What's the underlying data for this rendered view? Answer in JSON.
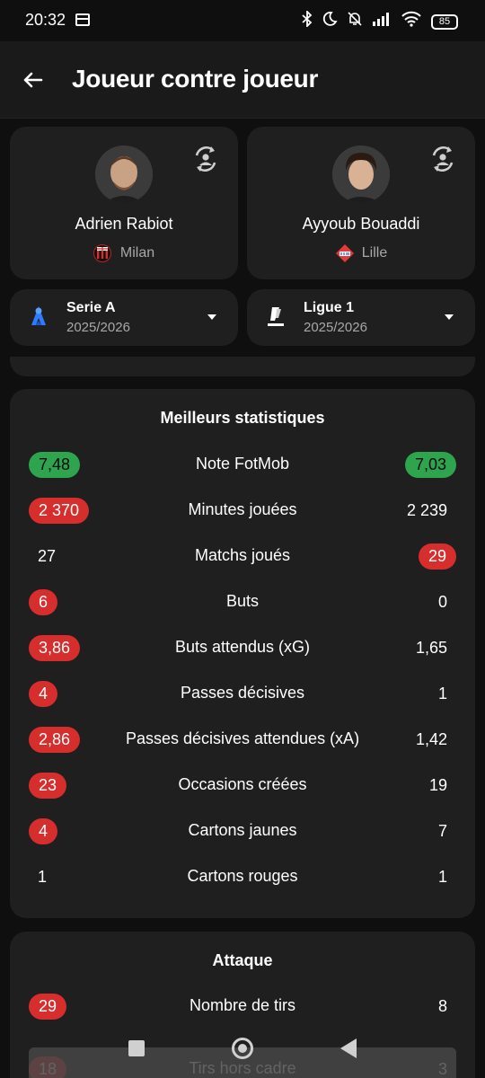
{
  "status_bar": {
    "time": "20:32",
    "battery": "85",
    "icons": [
      "bluetooth-icon",
      "moon-icon",
      "bell-off-icon",
      "signal-icon",
      "wifi-icon",
      "battery-icon"
    ]
  },
  "header": {
    "title": "Joueur contre joueur"
  },
  "players": [
    {
      "name": "Adrien Rabiot",
      "club": "Milan",
      "club_logo": "milan-crest-icon"
    },
    {
      "name": "Ayyoub Bouaddi",
      "club": "Lille",
      "club_logo": "lille-crest-icon"
    }
  ],
  "leagues": [
    {
      "name": "Serie A",
      "season": "2025/2026",
      "logo": "serie-a-logo"
    },
    {
      "name": "Ligue 1",
      "season": "2025/2026",
      "logo": "ligue-1-logo"
    }
  ],
  "best_stats": {
    "title": "Meilleurs statistiques",
    "rows": [
      {
        "label": "Note FotMob",
        "left": "7,48",
        "right": "7,03"
      },
      {
        "label": "Minutes jouées",
        "left": "2 370",
        "right": "2 239"
      },
      {
        "label": "Matchs joués",
        "left": "27",
        "right": "29"
      },
      {
        "label": "Buts",
        "left": "6",
        "right": "0"
      },
      {
        "label": "Buts attendus (xG)",
        "left": "3,86",
        "right": "1,65"
      },
      {
        "label": "Passes décisives",
        "left": "4",
        "right": "1"
      },
      {
        "label": "Passes décisives attendues (xA)",
        "left": "2,86",
        "right": "1,42"
      },
      {
        "label": "Occasions créées",
        "left": "23",
        "right": "19"
      },
      {
        "label": "Cartons jaunes",
        "left": "4",
        "right": "7"
      },
      {
        "label": "Cartons rouges",
        "left": "1",
        "right": "1"
      }
    ]
  },
  "attack": {
    "title": "Attaque",
    "rows": [
      {
        "label": "Nombre de tirs",
        "left": "29",
        "right": "8"
      },
      {
        "label": "Tirs hors cadre",
        "left": "18",
        "right": "3"
      }
    ]
  },
  "colors": {
    "background": "#0f0f0f",
    "card": "#1f1f1f",
    "highlight_green": "#2ea44f",
    "highlight_red": "#d62d2d",
    "secondary_text": "#a8a8a8"
  }
}
